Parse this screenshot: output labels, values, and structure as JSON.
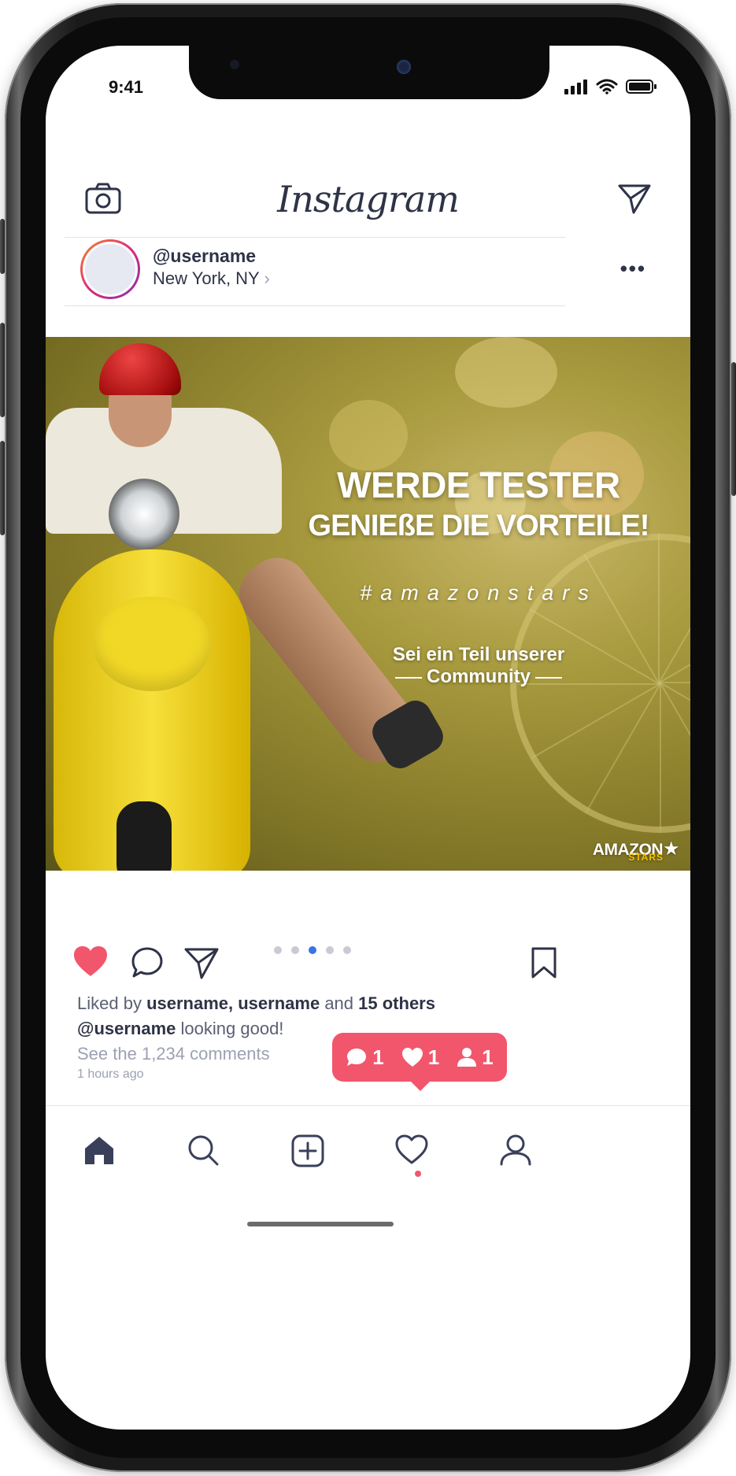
{
  "status_bar": {
    "time": "9:41"
  },
  "header": {
    "logo": "Instagram",
    "camera_icon": "camera-icon",
    "send_icon": "paper-plane-icon"
  },
  "post": {
    "username": "@username",
    "location": "New York, NY",
    "location_chevron": "›",
    "more": "•••",
    "image": {
      "title_line1": "WERDE TESTER",
      "title_line2": "GENIEßE DIE VORTEILE!",
      "hashtag": "#amazonstars",
      "subtitle_line1": "Sei ein Teil unserer",
      "subtitle_line2": "Community",
      "brand": "AMAZON",
      "brand_sub": "STARS"
    },
    "carousel": {
      "count": 5,
      "active_index": 2
    },
    "liked_prefix": "Liked by",
    "liked_users": "username, username",
    "liked_and": "and",
    "liked_others": "15 others",
    "caption_user": "@username",
    "caption_text": "looking good!",
    "comments_link": "See the 1,234 comments",
    "time_ago": "1 hours ago"
  },
  "notification": {
    "comments": "1",
    "likes": "1",
    "followers": "1",
    "color": "#f2566c"
  },
  "tabbar": {
    "items": [
      "home-icon",
      "search-icon",
      "add-post-icon",
      "activity-heart-icon",
      "profile-icon"
    ],
    "active": "home"
  },
  "colors": {
    "text_dark": "#2e3347",
    "text_muted": "#9ca1b2",
    "like_red": "#f2566c",
    "carousel_active": "#3b74e6"
  }
}
